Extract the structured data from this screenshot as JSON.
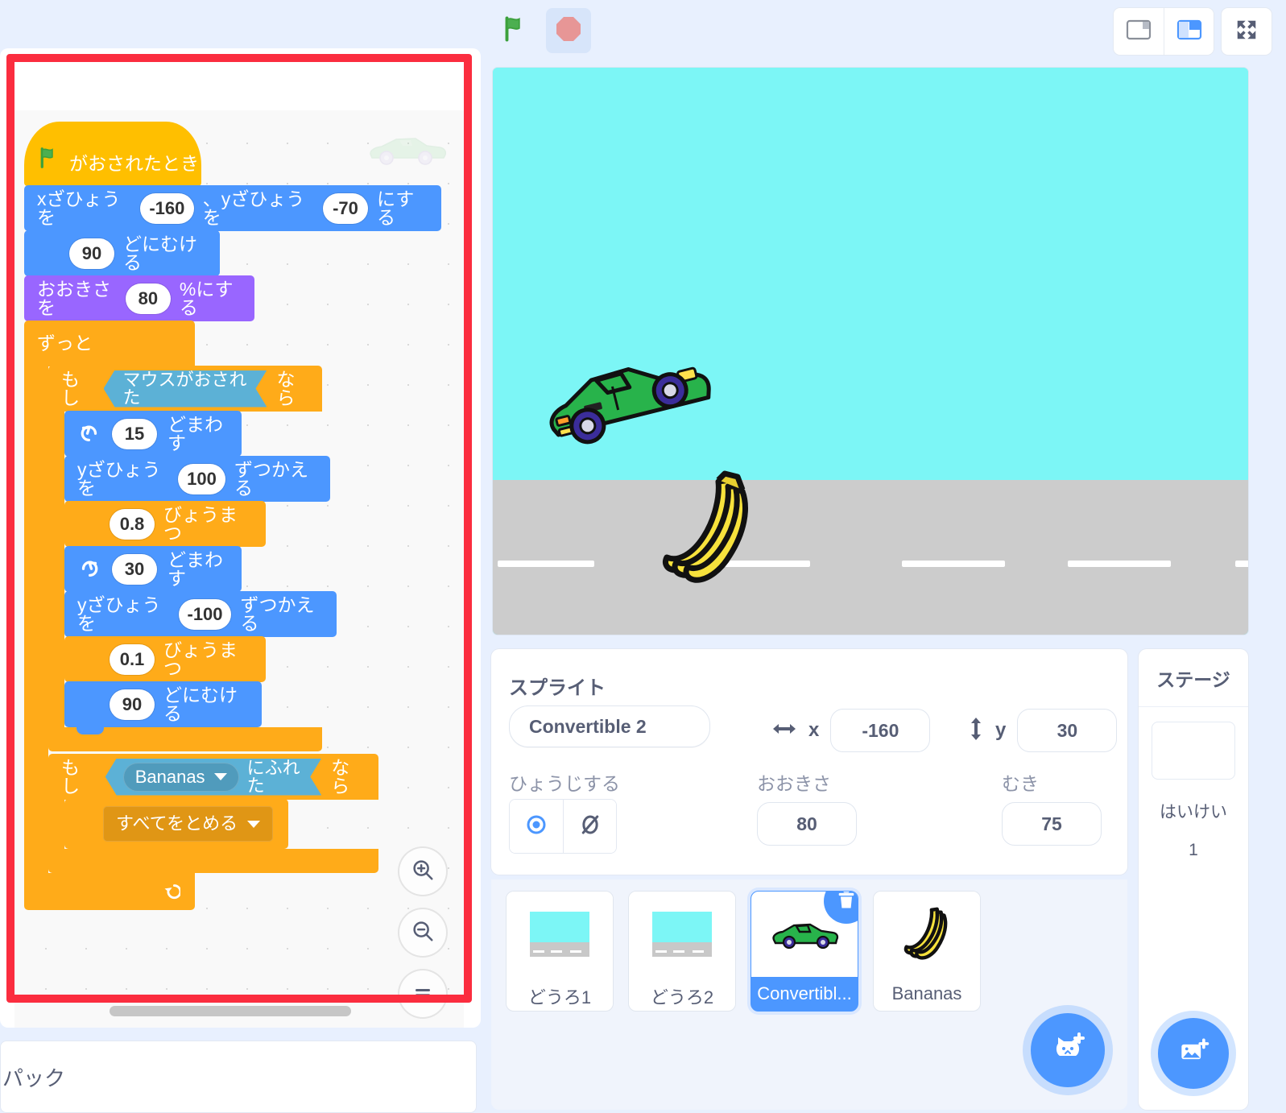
{
  "toolbar": {
    "green_flag": "green-flag-icon",
    "stop": "stop-sign-icon",
    "small_stage": "small-stage-layout-icon",
    "large_stage": "large-stage-layout-icon",
    "fullscreen": "fullscreen-icon"
  },
  "code_area": {
    "zoom_in": "zoom-in-icon",
    "zoom_out": "zoom-out-icon",
    "zoom_reset": "zoom-reset-icon",
    "watermark": "convertible-car-watermark"
  },
  "script": {
    "hat": {
      "label": "がおされたとき",
      "icon": "green-flag-icon"
    },
    "goto_xy": {
      "pre": "xざひょうを",
      "x": "-160",
      "mid": "、yざひょうを",
      "y": "-70",
      "post": "にする"
    },
    "point_direction": {
      "value": "90",
      "post": "どにむける"
    },
    "set_size": {
      "pre": "おおきさを",
      "value": "80",
      "post": "%にする"
    },
    "forever": {
      "label": "ずっと"
    },
    "if_mouse": {
      "pre": "もし",
      "condition": "マウスがおされた",
      "post": "なら"
    },
    "turn_ccw": {
      "icon": "turn-counterclockwise-icon",
      "value": "15",
      "post": "どまわす"
    },
    "change_y_1": {
      "pre": "yざひょうを",
      "value": "100",
      "post": "ずつかえる"
    },
    "wait_1": {
      "value": "0.8",
      "post": "びょうまつ"
    },
    "turn_cw": {
      "icon": "turn-clockwise-icon",
      "value": "30",
      "post": "どまわす"
    },
    "change_y_2": {
      "pre": "yざひょうを",
      "value": "-100",
      "post": "ずつかえる"
    },
    "wait_2": {
      "value": "0.1",
      "post": "びょうまつ"
    },
    "point_direction_2": {
      "value": "90",
      "post": "どにむける"
    },
    "if_touching": {
      "pre": "もし",
      "target": "Bananas",
      "mid": "にふれた",
      "post": "なら"
    },
    "stop_all": {
      "label": "すべてをとめる"
    }
  },
  "stage_scene": {
    "sky_color": "#7CF6F6",
    "road_color": "#CCCCCC",
    "car": "convertible-car-sprite",
    "bananas": "bananas-sprite"
  },
  "sprite_panel": {
    "title": "スプライト",
    "name_value": "Convertible 2",
    "x_label": "x",
    "x_value": "-160",
    "y_label": "y",
    "y_value": "30",
    "show_label": "ひょうじする",
    "size_label": "おおきさ",
    "size_value": "80",
    "direction_label": "むき",
    "direction_value": "75",
    "show_icon": "eye-visible-icon",
    "hide_icon": "eye-hidden-icon",
    "x_icon": "horizontal-arrows-icon",
    "y_icon": "vertical-arrows-icon"
  },
  "sprite_list": {
    "items": [
      {
        "name": "どうろ1",
        "thumb": "road-backdrop-thumb",
        "selected": false
      },
      {
        "name": "どうろ2",
        "thumb": "road-backdrop-thumb",
        "selected": false
      },
      {
        "name": "Convertibl...",
        "thumb": "convertible-car-thumb",
        "selected": true
      },
      {
        "name": "Bananas",
        "thumb": "bananas-thumb",
        "selected": false
      }
    ],
    "delete_icon": "delete-trash-icon",
    "add_sprite_icon": "add-sprite-cat-icon"
  },
  "stage_panel": {
    "title": "ステージ",
    "caption": "はいけい",
    "count": "1",
    "add_backdrop_icon": "add-backdrop-image-icon"
  },
  "backpack": {
    "label": "パック"
  },
  "colors": {
    "motion": "#4C97FF",
    "looks": "#9966FF",
    "control": "#FFAB19",
    "events": "#FFBF00",
    "sensing": "#5CB1D6",
    "highlight": "#FB2D3F",
    "accent": "#4C97FF"
  }
}
